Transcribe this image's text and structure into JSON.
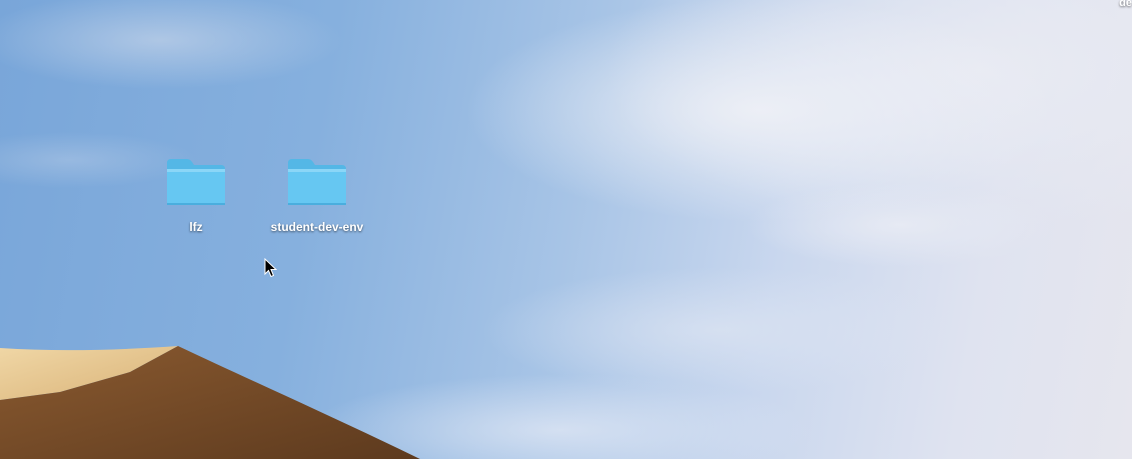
{
  "desktop": {
    "corner_label": "de",
    "folders": [
      {
        "label": "lfz",
        "icon": "folder-icon"
      },
      {
        "label": "student-dev-env",
        "icon": "folder-icon"
      }
    ],
    "cursor": "arrow-cursor-icon"
  },
  "colors": {
    "folder_top": "#6fcdf6",
    "folder_body": "#5ec1f0",
    "sky": "#86b0de",
    "dune_light": "#e9c88f",
    "dune_dark": "#6e4423"
  }
}
